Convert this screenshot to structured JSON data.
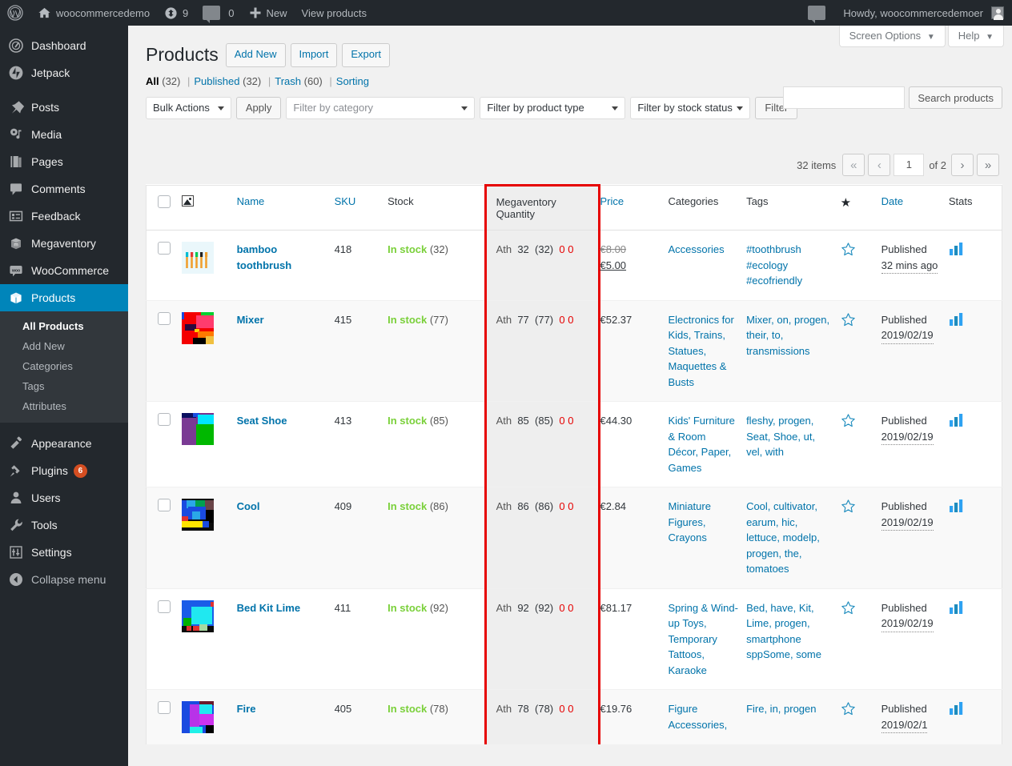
{
  "adminbar": {
    "logo_icon": "wordpress-logo-icon",
    "site_name": "woocommercedemo",
    "site_home_icon": "home-icon",
    "updates_icon": "updates-icon",
    "updates_count": "9",
    "comments_icon": "comment-bubble-icon",
    "comments_count": "0",
    "new_icon": "plus-icon",
    "new_label": "New",
    "view_products_label": "View products",
    "notifications_icon": "notifications-bubble-icon",
    "howdy": "Howdy, woocommercedemoer",
    "avatar_icon": "avatar-icon"
  },
  "sidebar": {
    "items": [
      {
        "label": "Dashboard",
        "icon": "dashboard-icon"
      },
      {
        "label": "Jetpack",
        "icon": "jetpack-icon"
      },
      {
        "label": "Posts",
        "icon": "pin-icon"
      },
      {
        "label": "Media",
        "icon": "media-icon"
      },
      {
        "label": "Pages",
        "icon": "pages-icon"
      },
      {
        "label": "Comments",
        "icon": "comment-bubble-icon"
      },
      {
        "label": "Feedback",
        "icon": "feedback-icon"
      },
      {
        "label": "Megaventory",
        "icon": "megaventory-box-icon"
      },
      {
        "label": "WooCommerce",
        "icon": "woocommerce-icon"
      },
      {
        "label": "Products",
        "icon": "products-box-icon",
        "current": true
      }
    ],
    "submenu": [
      {
        "label": "All Products",
        "current": true
      },
      {
        "label": "Add New"
      },
      {
        "label": "Categories"
      },
      {
        "label": "Tags"
      },
      {
        "label": "Attributes"
      }
    ],
    "items_bottom": [
      {
        "label": "Appearance",
        "icon": "brush-icon"
      },
      {
        "label": "Plugins",
        "icon": "plug-icon",
        "badge": "6"
      },
      {
        "label": "Users",
        "icon": "user-icon"
      },
      {
        "label": "Tools",
        "icon": "wrench-icon"
      },
      {
        "label": "Settings",
        "icon": "sliders-icon"
      }
    ],
    "collapse": {
      "label": "Collapse menu",
      "icon": "collapse-arrow-icon"
    }
  },
  "screen_meta": {
    "screen_options_label": "Screen Options",
    "help_label": "Help",
    "caret": "▼"
  },
  "header": {
    "title": "Products",
    "add_new_label": "Add New",
    "import_label": "Import",
    "export_label": "Export"
  },
  "views": {
    "all_label": "All",
    "all_count": "(32)",
    "published_label": "Published",
    "published_count": "(32)",
    "trash_label": "Trash",
    "trash_count": "(60)",
    "sorting_label": "Sorting",
    "divider": "|"
  },
  "search": {
    "value": "",
    "placeholder": "",
    "button_label": "Search products"
  },
  "tablenav": {
    "bulk_actions_label": "Bulk Actions",
    "apply_label": "Apply",
    "filter_category_label": "Filter by category",
    "filter_product_type_label": "Filter by product type",
    "filter_stock_status_label": "Filter by stock status",
    "filter_label": "Filter"
  },
  "pagination": {
    "items_text": "32 items",
    "first_label": "«",
    "prev_label": "‹",
    "current_page": "1",
    "of_text": "of 2",
    "next_label": "›",
    "last_label": "»"
  },
  "table": {
    "columns": {
      "cb": "",
      "image": "image-icon",
      "name": "Name",
      "sku": "SKU",
      "stock": "Stock",
      "megaventory_quantity": "Megaventory Quantity",
      "price": "Price",
      "categories": "Categories",
      "tags": "Tags",
      "featured": "star-icon",
      "date": "Date",
      "stats": "Stats"
    },
    "rows": [
      {
        "name": "bamboo toothbrush",
        "sku": "418",
        "stock_status": "In stock",
        "stock_count": "(32)",
        "mv_location": "Ath",
        "mv_qty": "32",
        "mv_alloc": "(32)",
        "mv_zero_a": "0",
        "mv_zero_b": "0",
        "price_old": "€8.00",
        "price_new": "€5.00",
        "categories": [
          "Accessories"
        ],
        "tags": [
          "#toothbrush",
          "#ecology",
          "#ecofriendly"
        ],
        "featured": "star-outline-icon",
        "date_status": "Published",
        "date_value": "32 mins ago",
        "stats": "bar-chart-icon",
        "thumb": "toothbrushes"
      },
      {
        "name": "Mixer",
        "sku": "415",
        "stock_status": "In stock",
        "stock_count": "(77)",
        "mv_location": "Ath",
        "mv_qty": "77",
        "mv_alloc": "(77)",
        "mv_zero_a": "0",
        "mv_zero_b": "0",
        "price_old": "",
        "price_new": "€52.37",
        "categories": [
          "Electronics for Kids, Trains, Statues, Maquettes & Busts"
        ],
        "tags": [
          "Mixer, on, progen, their, to, transmissions"
        ],
        "featured": "star-outline-icon",
        "date_status": "Published",
        "date_value": "2019/02/19",
        "stats": "bar-chart-icon",
        "thumb": "red-blocks"
      },
      {
        "name": "Seat Shoe",
        "sku": "413",
        "stock_status": "In stock",
        "stock_count": "(85)",
        "mv_location": "Ath",
        "mv_qty": "85",
        "mv_alloc": "(85)",
        "mv_zero_a": "0",
        "mv_zero_b": "0",
        "price_old": "",
        "price_new": "€44.30",
        "categories": [
          "Kids' Furniture & Room Décor, Paper, Games"
        ],
        "tags": [
          "fleshy, progen, Seat, Shoe, ut, vel, with"
        ],
        "featured": "star-outline-icon",
        "date_status": "Published",
        "date_value": "2019/02/19",
        "stats": "bar-chart-icon",
        "thumb": "purple-green-blocks"
      },
      {
        "name": "Cool",
        "sku": "409",
        "stock_status": "In stock",
        "stock_count": "(86)",
        "mv_location": "Ath",
        "mv_qty": "86",
        "mv_alloc": "(86)",
        "mv_zero_a": "0",
        "mv_zero_b": "0",
        "price_old": "",
        "price_new": "€2.84",
        "categories": [
          "Miniature Figures, Crayons"
        ],
        "tags": [
          "Cool, cultivator, earum, hic, lettuce, modelp, progen, the, tomatoes"
        ],
        "featured": "star-outline-icon",
        "date_status": "Published",
        "date_value": "2019/02/19",
        "stats": "bar-chart-icon",
        "thumb": "blue-yellow-blocks"
      },
      {
        "name": "Bed Kit Lime",
        "sku": "411",
        "stock_status": "In stock",
        "stock_count": "(92)",
        "mv_location": "Ath",
        "mv_qty": "92",
        "mv_alloc": "(92)",
        "mv_zero_a": "0",
        "mv_zero_b": "0",
        "price_old": "",
        "price_new": "€81.17",
        "categories": [
          "Spring & Wind-up Toys, Temporary Tattoos, Karaoke"
        ],
        "tags": [
          "Bed, have, Kit, Lime, progen, smartphone sppSome, some"
        ],
        "featured": "star-outline-icon",
        "date_status": "Published",
        "date_value": "2019/02/19",
        "stats": "bar-chart-icon",
        "thumb": "cyan-blue-blocks"
      },
      {
        "name": "Fire",
        "sku": "405",
        "stock_status": "In stock",
        "stock_count": "(78)",
        "mv_location": "Ath",
        "mv_qty": "78",
        "mv_alloc": "(78)",
        "mv_zero_a": "0",
        "mv_zero_b": "0",
        "price_old": "",
        "price_new": "€19.76",
        "categories": [
          "Figure Accessories,"
        ],
        "tags": [
          "Fire, in, progen"
        ],
        "featured": "star-outline-icon",
        "date_status": "Published",
        "date_value": "2019/02/1",
        "stats": "bar-chart-icon",
        "thumb": "magenta-blue-blocks"
      }
    ]
  },
  "colors": {
    "admin_dark": "#23282d",
    "admin_submenu": "#32373c",
    "accent_blue": "#0073aa",
    "current_blue": "#0085ba",
    "in_stock_green": "#7ad03a",
    "highlight_red": "#e60000",
    "badge_red": "#d54e21"
  }
}
